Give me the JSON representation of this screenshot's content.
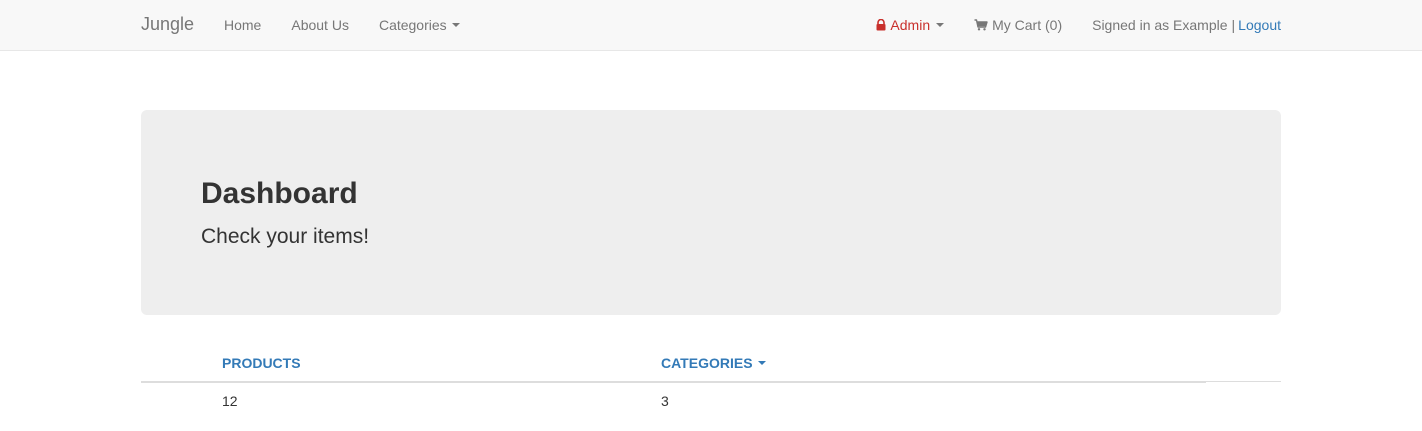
{
  "navbar": {
    "brand": "Jungle",
    "links": {
      "home": "Home",
      "about": "About Us",
      "categories": "Categories"
    },
    "admin_label": "Admin",
    "cart_label": "My Cart (0)",
    "signed_in_text": "Signed in as Example",
    "separator": "|",
    "logout_label": "Logout",
    "colors": {
      "background": "#f8f8f8",
      "admin": "#c9302c",
      "link": "#337ab7"
    },
    "icons": {
      "admin": "lock-icon",
      "cart": "shopping-cart-icon",
      "dropdown": "caret-down-icon"
    }
  },
  "jumbotron": {
    "title": "Dashboard",
    "subtitle": "Check your items!"
  },
  "stats": {
    "headers": {
      "products": "PRODUCTS",
      "categories": "CATEGORIES"
    },
    "values": {
      "products": "12",
      "categories": "3"
    }
  }
}
